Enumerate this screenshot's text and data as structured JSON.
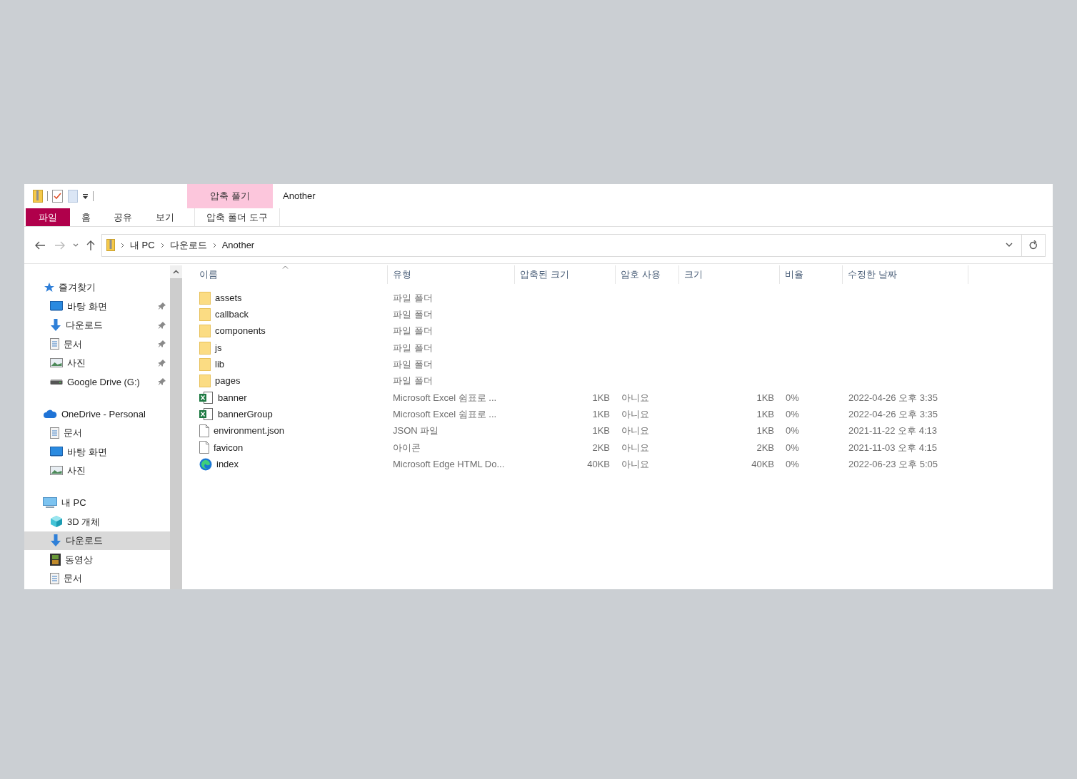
{
  "title_bar": {
    "context_tab": "압축 풀기",
    "title": "Another"
  },
  "ribbon_tabs": [
    {
      "label": "파일",
      "selected": true
    },
    {
      "label": "홈",
      "selected": false
    },
    {
      "label": "공유",
      "selected": false
    },
    {
      "label": "보기",
      "selected": false
    },
    {
      "label": "압축 폴더 도구",
      "selected": false
    }
  ],
  "address": {
    "path": [
      "내 PC",
      "다운로드",
      "Another"
    ]
  },
  "sidebar": [
    {
      "label": "즐겨찾기",
      "kind": "star",
      "children": [
        {
          "label": "바탕 화면",
          "kind": "desktop",
          "pinned": true,
          "selected": false
        },
        {
          "label": "다운로드",
          "kind": "download",
          "pinned": true,
          "selected": false
        },
        {
          "label": "문서",
          "kind": "document",
          "pinned": true,
          "selected": false
        },
        {
          "label": "사진",
          "kind": "pictures",
          "pinned": true,
          "selected": false
        },
        {
          "label": "Google Drive (G:)",
          "kind": "drive",
          "pinned": true,
          "selected": false
        }
      ]
    },
    {
      "label": "OneDrive - Personal",
      "kind": "cloud",
      "children": [
        {
          "label": "문서",
          "kind": "document",
          "pinned": false,
          "selected": false
        },
        {
          "label": "바탕 화면",
          "kind": "desktop",
          "pinned": false,
          "selected": false
        },
        {
          "label": "사진",
          "kind": "pictures",
          "pinned": false,
          "selected": false
        }
      ]
    },
    {
      "label": "내 PC",
      "kind": "pc",
      "children": [
        {
          "label": "3D 개체",
          "kind": "cube",
          "pinned": false,
          "selected": false
        },
        {
          "label": "다운로드",
          "kind": "download",
          "pinned": false,
          "selected": true
        },
        {
          "label": "동영상",
          "kind": "video",
          "pinned": false,
          "selected": false
        },
        {
          "label": "문서",
          "kind": "document",
          "pinned": false,
          "selected": false
        }
      ]
    }
  ],
  "table": {
    "columns": [
      "이름",
      "유형",
      "압축된 크기",
      "암호 사용",
      "크기",
      "비율",
      "수정한 날짜"
    ],
    "rows": [
      {
        "kind": "folder",
        "name": "assets",
        "type": "파일 폴더"
      },
      {
        "kind": "folder",
        "name": "callback",
        "type": "파일 폴더"
      },
      {
        "kind": "folder",
        "name": "components",
        "type": "파일 폴더"
      },
      {
        "kind": "folder",
        "name": "js",
        "type": "파일 폴더"
      },
      {
        "kind": "folder",
        "name": "lib",
        "type": "파일 폴더"
      },
      {
        "kind": "folder",
        "name": "pages",
        "type": "파일 폴더"
      },
      {
        "kind": "excel",
        "name": "banner",
        "type": "Microsoft Excel 쉼표로 ...",
        "compressed": "1KB",
        "password": "아니요",
        "size": "1KB",
        "ratio": "0%",
        "modified": "2022-04-26 오후 3:35"
      },
      {
        "kind": "excel",
        "name": "bannerGroup",
        "type": "Microsoft Excel 쉼표로 ...",
        "compressed": "1KB",
        "password": "아니요",
        "size": "1KB",
        "ratio": "0%",
        "modified": "2022-04-26 오후 3:35"
      },
      {
        "kind": "file",
        "name": "environment.json",
        "type": "JSON 파일",
        "compressed": "1KB",
        "password": "아니요",
        "size": "1KB",
        "ratio": "0%",
        "modified": "2021-11-22 오후 4:13"
      },
      {
        "kind": "file",
        "name": "favicon",
        "type": "아이콘",
        "compressed": "2KB",
        "password": "아니요",
        "size": "2KB",
        "ratio": "0%",
        "modified": "2021-11-03 오후 4:15"
      },
      {
        "kind": "edge",
        "name": "index",
        "type": "Microsoft Edge HTML Do...",
        "compressed": "40KB",
        "password": "아니요",
        "size": "40KB",
        "ratio": "0%",
        "modified": "2022-06-23 오후 5:05"
      }
    ]
  }
}
